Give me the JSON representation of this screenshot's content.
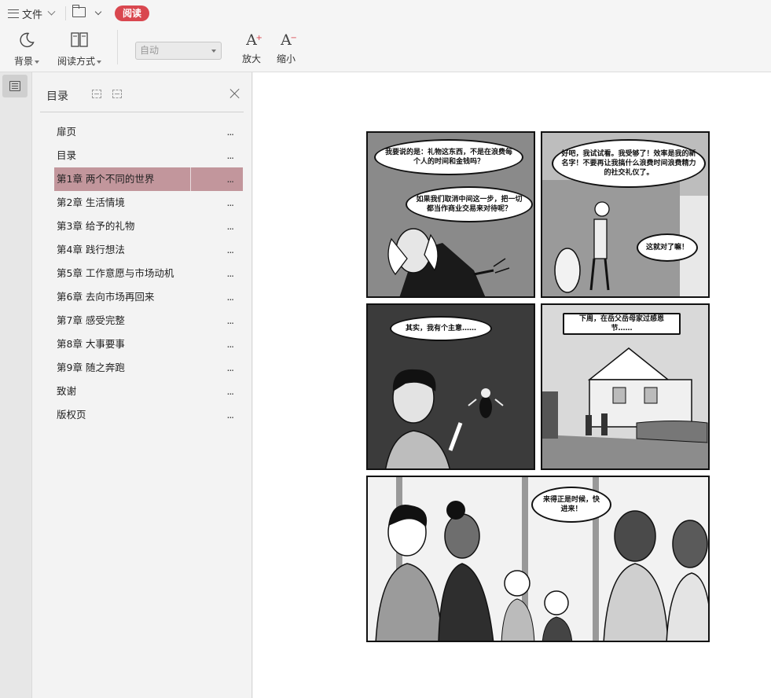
{
  "toolbar": {
    "file_label": "文件",
    "read_badge": "阅读",
    "background_label": "背景",
    "read_mode_label": "阅读方式",
    "auto_select_value": "自动",
    "zoom_in_label": "放大",
    "zoom_out_label": "缩小",
    "zoom_in_sign": "+",
    "zoom_out_sign": "−"
  },
  "toc": {
    "title": "目录",
    "more_glyph": "...",
    "items": [
      {
        "label": "扉页"
      },
      {
        "label": "目录"
      },
      {
        "label": "第1章 两个不同的世界"
      },
      {
        "label": "第2章 生活情境"
      },
      {
        "label": "第3章 给予的礼物"
      },
      {
        "label": "第4章 践行想法"
      },
      {
        "label": "第5章 工作意愿与市场动机"
      },
      {
        "label": "第6章 去向市场再回来"
      },
      {
        "label": "第7章 感受完整"
      },
      {
        "label": "第8章 大事要事"
      },
      {
        "label": "第9章 随之奔跑"
      },
      {
        "label": "致谢"
      },
      {
        "label": "版权页"
      }
    ],
    "active_index": 2
  },
  "comic": {
    "panel1_bubble1": "我要说的是：礼物这东西，不是在浪费每个人的时间和金钱吗？",
    "panel1_bubble2": "如果我们取消中间这一步，把一切都当作商业交易来对待呢？",
    "panel2_bubble1": "好吧，我试试看。我受够了！效率是我的新名字！不要再让我搞什么浪费时间浪费精力的社交礼仪了。",
    "panel2_bubble2": "这就对了嘛！",
    "panel3_bubble1": "其实，我有个主意……",
    "panel4_caption": "下周，在岳父岳母家过感恩节……",
    "panel5_bubble1": "来得正是时候，快进来！"
  },
  "colors": {
    "accent_red": "#d9474f",
    "toc_active": "#c2969c"
  }
}
